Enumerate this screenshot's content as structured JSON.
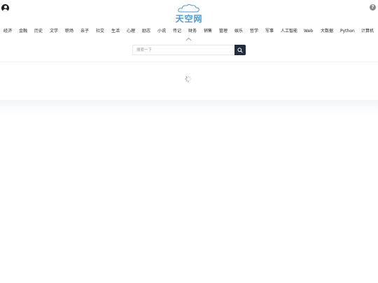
{
  "header": {
    "logo_text": "天空网",
    "user_icon": "user-circle-icon",
    "help_icon": "question-icon",
    "help_glyph": "?"
  },
  "nav": {
    "items": [
      "经济",
      "金融",
      "历史",
      "文学",
      "职场",
      "亲子",
      "社交",
      "生活",
      "心理",
      "励志",
      "小说",
      "传记",
      "财务",
      "销售",
      "管理",
      "娱乐",
      "哲学",
      "军事",
      "人工智能",
      "Web",
      "大数据",
      "Python",
      "计算机"
    ]
  },
  "search": {
    "placeholder": "搜索一下",
    "value": "",
    "button_icon": "search-icon"
  },
  "colors": {
    "logo": "#4a9ad8",
    "search_button": "#1f2d3d"
  }
}
